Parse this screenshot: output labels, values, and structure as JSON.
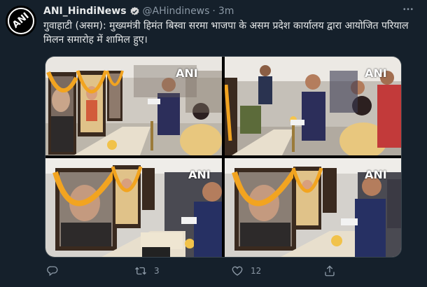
{
  "tweet": {
    "display_name": "ANI_HindiNews",
    "handle": "@AHindinews",
    "separator": "·",
    "time": "3m",
    "text": "गुवाहाटी (असम): मुख्यमंत्री हिमंत बिस्वा सरमा भाजपा के असम प्रदेश कार्यालय द्वारा आयोजित परियाल मिलन समारोह में शामिल हुए।",
    "avatar_text": "ANI",
    "watermark": "ANI",
    "retweets": "3",
    "likes": "12"
  },
  "icons": [
    "verified-icon",
    "more-icon",
    "reply-icon",
    "retweet-icon",
    "like-icon",
    "share-icon"
  ],
  "colors": {
    "background": "#15202b",
    "accent": "#1d9bf0",
    "muted": "#8b98a5"
  }
}
